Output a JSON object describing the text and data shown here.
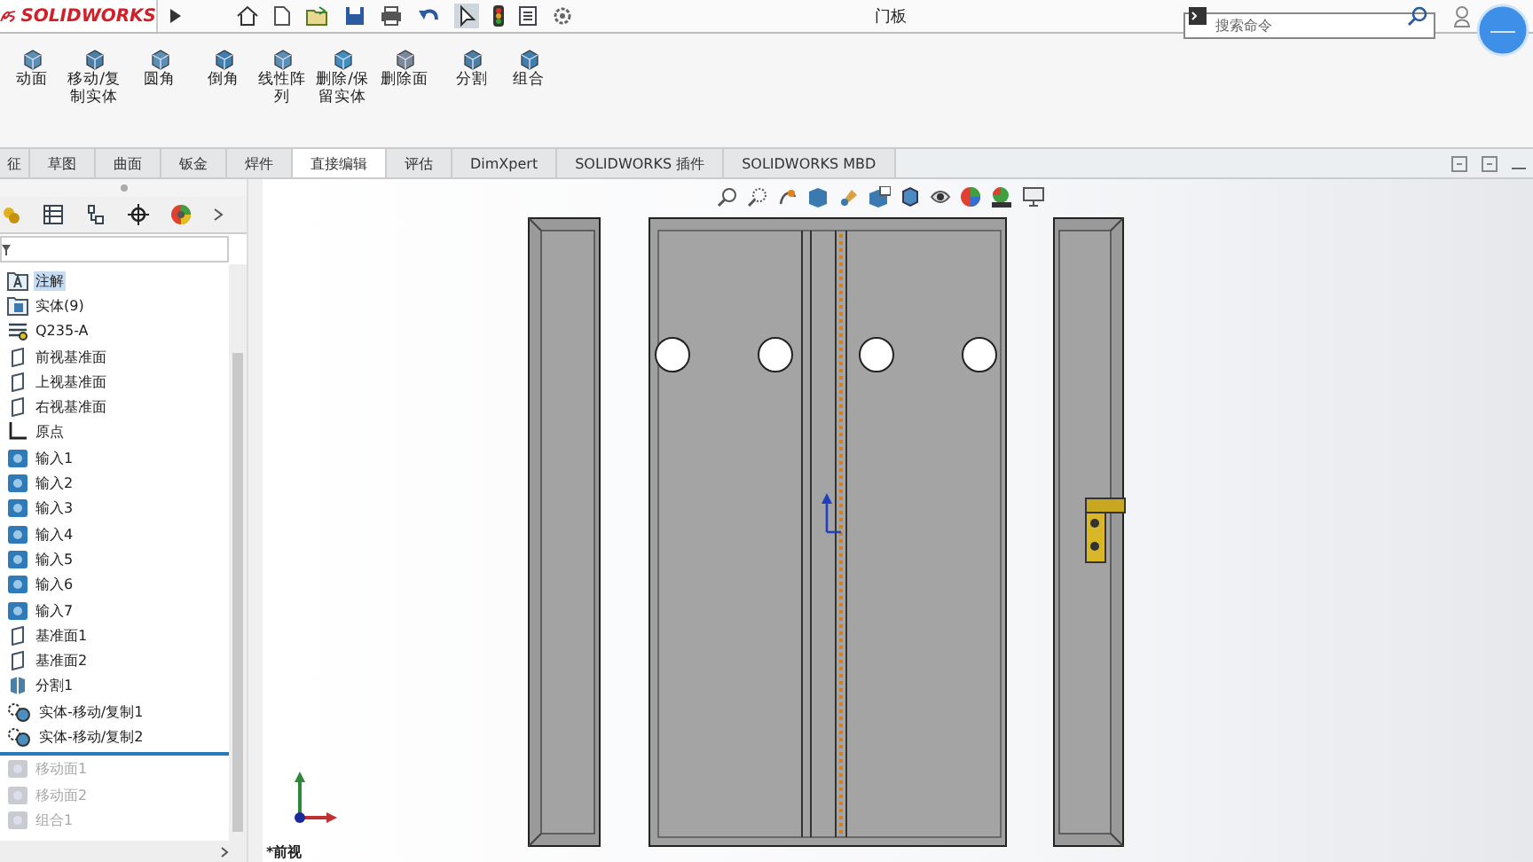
{
  "app": {
    "logo": "SOLIDWORKS",
    "title": "门板",
    "search": {
      "placeholder": "搜索命令"
    }
  },
  "ribbon": {
    "buttons": [
      {
        "label": "动面",
        "kind": "move-face"
      },
      {
        "label": "移动/复制实体",
        "kind": "move-body"
      },
      {
        "label": "圆角",
        "kind": "fillet"
      },
      {
        "label": "倒角",
        "kind": "chamfer"
      },
      {
        "label": "线性阵列",
        "kind": "pattern"
      },
      {
        "label": "删除/保留实体",
        "kind": "delete-body"
      },
      {
        "label": "删除面",
        "kind": "delete-face"
      },
      {
        "label": "分割",
        "kind": "split"
      },
      {
        "label": "组合",
        "kind": "combine"
      }
    ]
  },
  "tabs": [
    {
      "label": "征",
      "selected": false
    },
    {
      "label": "草图",
      "selected": false
    },
    {
      "label": "曲面",
      "selected": false
    },
    {
      "label": "钣金",
      "selected": false
    },
    {
      "label": "焊件",
      "selected": false
    },
    {
      "label": "直接编辑",
      "selected": true
    },
    {
      "label": "评估",
      "selected": false
    },
    {
      "label": "DimXpert",
      "selected": false
    },
    {
      "label": "SOLIDWORKS 插件",
      "selected": false
    },
    {
      "label": "SOLIDWORKS MBD",
      "selected": false
    }
  ],
  "feature_tree": {
    "items": [
      {
        "label": "注解",
        "kind": "annotation",
        "selected": true,
        "disabled": false
      },
      {
        "label": "实体(9)",
        "kind": "solids",
        "selected": false,
        "disabled": false
      },
      {
        "label": "Q235-A",
        "kind": "material",
        "selected": false,
        "disabled": false
      },
      {
        "label": "前视基准面",
        "kind": "plane",
        "selected": false,
        "disabled": false
      },
      {
        "label": "上视基准面",
        "kind": "plane",
        "selected": false,
        "disabled": false
      },
      {
        "label": "右视基准面",
        "kind": "plane",
        "selected": false,
        "disabled": false
      },
      {
        "label": "原点",
        "kind": "origin",
        "selected": false,
        "disabled": false
      },
      {
        "label": "输入1",
        "kind": "import",
        "selected": false,
        "disabled": false
      },
      {
        "label": "输入2",
        "kind": "import",
        "selected": false,
        "disabled": false
      },
      {
        "label": "输入3",
        "kind": "import",
        "selected": false,
        "disabled": false
      },
      {
        "label": "输入4",
        "kind": "import",
        "selected": false,
        "disabled": false
      },
      {
        "label": "输入5",
        "kind": "import",
        "selected": false,
        "disabled": false
      },
      {
        "label": "输入6",
        "kind": "import",
        "selected": false,
        "disabled": false
      },
      {
        "label": "输入7",
        "kind": "import",
        "selected": false,
        "disabled": false
      },
      {
        "label": "基准面1",
        "kind": "plane",
        "selected": false,
        "disabled": false
      },
      {
        "label": "基准面2",
        "kind": "plane",
        "selected": false,
        "disabled": false
      },
      {
        "label": "分割1",
        "kind": "split",
        "selected": false,
        "disabled": false
      },
      {
        "label": "实体-移动/复制1",
        "kind": "move-body",
        "selected": false,
        "disabled": false
      },
      {
        "label": "实体-移动/复制2",
        "kind": "move-body",
        "selected": false,
        "disabled": false
      },
      {
        "kind": "rollback-bar"
      },
      {
        "label": "移动面1",
        "kind": "move-face",
        "selected": false,
        "disabled": true
      },
      {
        "label": "移动面2",
        "kind": "move-face",
        "selected": false,
        "disabled": true
      },
      {
        "label": "组合1",
        "kind": "combine",
        "selected": false,
        "disabled": true
      }
    ]
  },
  "viewport": {
    "view_label": "*前视"
  }
}
